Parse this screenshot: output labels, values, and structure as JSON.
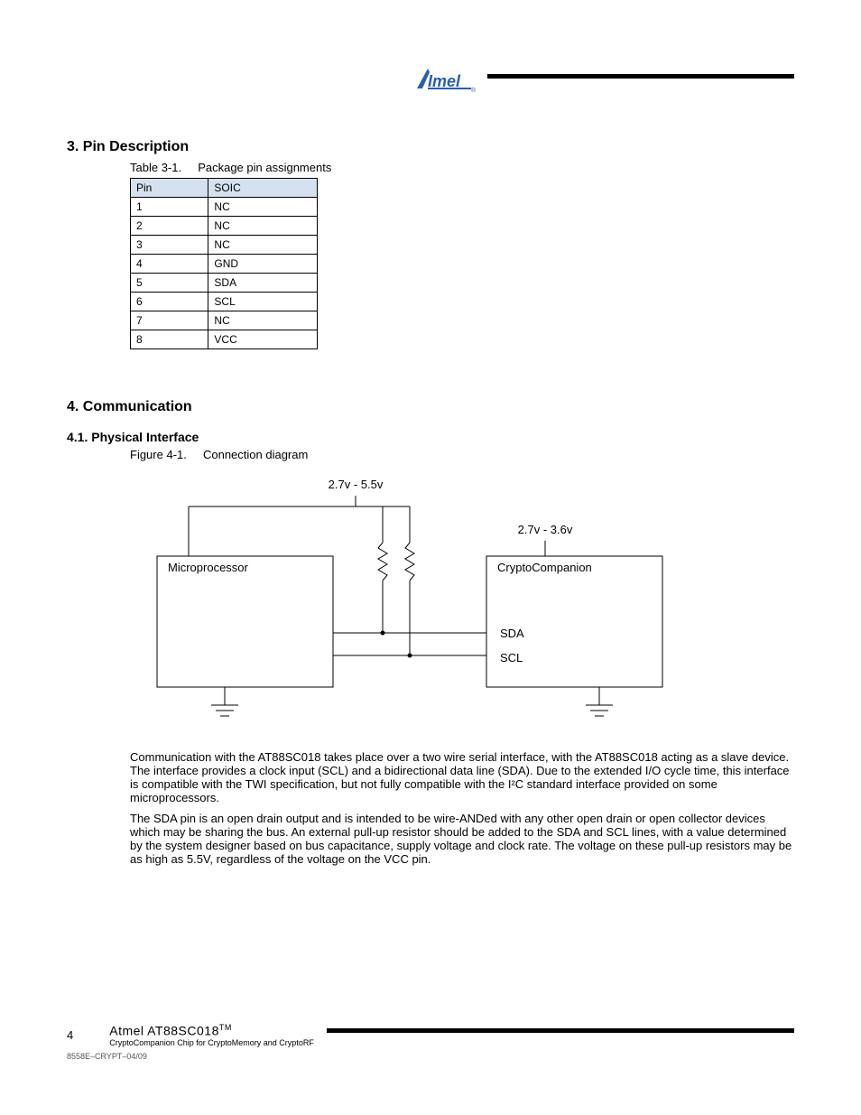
{
  "header": {
    "logo_name": "Atmel"
  },
  "section3": {
    "heading": "3. Pin Description",
    "table": {
      "caption_label": "Table 3-1.",
      "caption_title": "Package pin assignments",
      "headers": [
        "Pin",
        "SOIC"
      ],
      "rows": [
        [
          "1",
          "NC"
        ],
        [
          "2",
          "NC"
        ],
        [
          "3",
          "NC"
        ],
        [
          "4",
          "GND"
        ],
        [
          "5",
          "SDA"
        ],
        [
          "6",
          "SCL"
        ],
        [
          "7",
          "NC"
        ],
        [
          "8",
          "VCC"
        ]
      ]
    }
  },
  "section4": {
    "heading": "4. Communication",
    "sub": {
      "heading": "4.1. Physical Interface",
      "fig_label": "Figure 4-1.",
      "fig_title": "Connection diagram",
      "diagram": {
        "vleft": "2.7v - 5.5v",
        "vright": "2.7v - 3.6v",
        "left_box": "Microprocessor",
        "right_box": "CryptoCompanion",
        "sda": "SDA",
        "scl": "SCL"
      },
      "para1": "Communication with the AT88SC018 takes place over a two wire serial interface, with the AT88SC018 acting as a slave device. The interface provides a clock input (SCL) and a bidirectional data line (SDA). Due to the extended I/O cycle time, this interface is compatible with the TWI specification, but not fully compatible with the I²C standard interface provided on some microprocessors.",
      "para2": "The SDA pin is an open drain output and is intended to be wire-ANDed with any other open drain or open collector devices which may be sharing the bus. An external pull-up resistor should be added to the SDA and SCL lines, with a value determined by the system designer based on bus capacitance, supply voltage and clock rate. The voltage on these pull-up resistors may be as high as 5.5V, regardless of the voltage on the VCC pin."
    }
  },
  "footer": {
    "page": "4",
    "brand1": "Atmel AT88SC018",
    "tm": "TM",
    "brand2": "CryptoCompanion Chip for CryptoMemory and CryptoRF",
    "doccode": "8558E–CRYPT–04/09"
  }
}
